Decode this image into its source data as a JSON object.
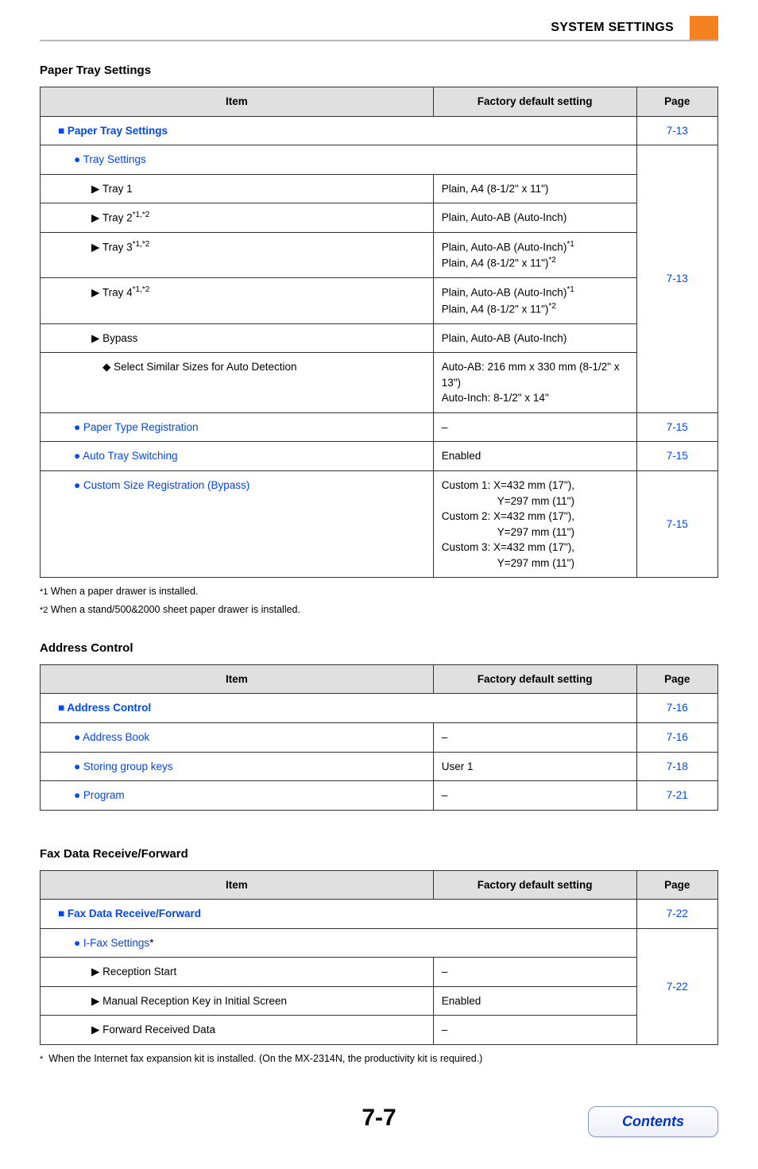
{
  "header": {
    "title": "SYSTEM SETTINGS"
  },
  "page_number": "7-7",
  "contents_label": "Contents",
  "sections": {
    "paper_tray": {
      "title": "Paper Tray Settings",
      "th": {
        "item": "Item",
        "default": "Factory default setting",
        "page": "Page"
      },
      "rows": {
        "r0": {
          "label": "Paper Tray Settings",
          "page": "7-13"
        },
        "r1": {
          "label": "Tray Settings"
        },
        "r2": {
          "label": "Tray 1",
          "default": "Plain, A4 (8-1/2\" x 11\")"
        },
        "r3": {
          "label": "Tray 2",
          "sup": "*1,*2",
          "default": "Plain, Auto-AB (Auto-Inch)"
        },
        "r4": {
          "label": "Tray 3",
          "sup": "*1,*2",
          "default_l1": "Plain, Auto-AB (Auto-Inch)",
          "default_s1": "*1",
          "default_l2": "Plain, A4 (8-1/2\" x 11\")",
          "default_s2": "*2"
        },
        "r5": {
          "label": "Tray 4",
          "sup": "*1,*2",
          "default_l1": "Plain, Auto-AB (Auto-Inch)",
          "default_s1": "*1",
          "default_l2": "Plain, A4 (8-1/2\" x 11\")",
          "default_s2": "*2"
        },
        "r6": {
          "label": "Bypass",
          "default": "Plain, Auto-AB (Auto-Inch)"
        },
        "r7": {
          "label": "Select Similar Sizes for Auto Detection",
          "default_l1": "Auto-AB: 216 mm x 330 mm (8-1/2\" x 13\")",
          "default_l2": "Auto-Inch: 8-1/2\" x 14\""
        },
        "page_tray": "7-13",
        "r8": {
          "label": "Paper Type Registration",
          "default": "–",
          "page": "7-15"
        },
        "r9": {
          "label": "Auto Tray Switching",
          "default": "Enabled",
          "page": "7-15"
        },
        "r10": {
          "label": "Custom Size Registration (Bypass)",
          "d1": "Custom 1: X=432 mm (17\"),",
          "d1b": "Y=297 mm (11\")",
          "d2": "Custom 2: X=432 mm (17\"),",
          "d2b": "Y=297 mm (11\")",
          "d3": "Custom 3: X=432 mm (17\"),",
          "d3b": "Y=297 mm (11\")",
          "page": "7-15"
        }
      },
      "footnotes": {
        "f1_mark": "*1",
        "f1": "When a paper drawer is installed.",
        "f2_mark": "*2",
        "f2": "When a stand/500&2000 sheet paper drawer is installed."
      }
    },
    "address_control": {
      "title": "Address Control",
      "th": {
        "item": "Item",
        "default": "Factory default setting",
        "page": "Page"
      },
      "rows": {
        "r0": {
          "label": "Address Control",
          "page": "7-16"
        },
        "r1": {
          "label": "Address Book",
          "default": "–",
          "page": "7-16"
        },
        "r2": {
          "label": "Storing group keys",
          "default": "User 1",
          "page": "7-18"
        },
        "r3": {
          "label": "Program",
          "default": "–",
          "page": "7-21"
        }
      }
    },
    "fax": {
      "title": "Fax Data Receive/Forward",
      "th": {
        "item": "Item",
        "default": "Factory default setting",
        "page": "Page"
      },
      "rows": {
        "r0": {
          "label": "Fax Data Receive/Forward",
          "page": "7-22"
        },
        "r1": {
          "label": "I-Fax Settings",
          "asterisk": "*"
        },
        "r2": {
          "label": "Reception Start",
          "default": "–"
        },
        "r3": {
          "label": "Manual Reception Key in Initial Screen",
          "default": "Enabled"
        },
        "r4": {
          "label": "Forward Received Data",
          "default": "–"
        },
        "page_group": "7-22"
      },
      "footnote": {
        "mark": "*",
        "text": "When the Internet fax expansion kit is installed. (On the MX-2314N, the productivity kit is required.)"
      }
    }
  }
}
